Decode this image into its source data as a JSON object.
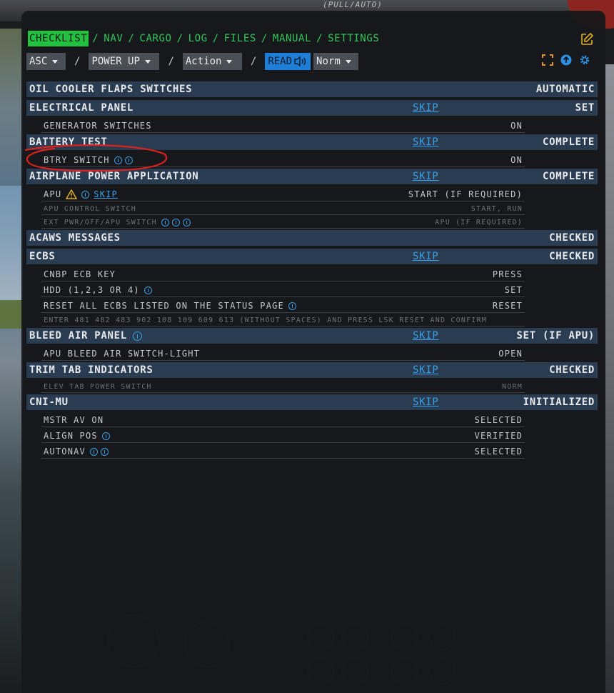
{
  "background": {
    "top_label": "(PULL/AUTO)"
  },
  "tabs": [
    {
      "label": "CHECKLIST",
      "active": true
    },
    {
      "label": "NAV"
    },
    {
      "label": "CARGO"
    },
    {
      "label": "LOG"
    },
    {
      "label": "FILES"
    },
    {
      "label": "MANUAL"
    },
    {
      "label": "SETTINGS"
    }
  ],
  "toolbar": {
    "dropdown_1": "ASC",
    "dropdown_2": "POWER UP",
    "dropdown_3": "Action",
    "separator": "/",
    "read_label": "READ",
    "mode": "Norm"
  },
  "colors": {
    "tab_green": "#32c75a",
    "section_bg": "#2a3c52",
    "link_blue": "#3aa0e6",
    "read_blue": "#1f7fd6",
    "icon_orange": "#e8912b",
    "warning_yellow": "#e0b020",
    "annotation_red": "#e0201a"
  },
  "icons": {
    "edit": "pencil-square-icon",
    "fullscreen": "expand-corners-icon",
    "upload": "arrow-up-circle-icon",
    "settings": "gear-icon",
    "speaker": "speaker-icon",
    "info": "info-circle-icon",
    "warning": "warning-triangle-icon"
  },
  "checklist": {
    "sections": {
      "oil_cooler": {
        "label": "OIL COOLER FLAPS SWITCHES",
        "value": "AUTOMATIC"
      },
      "electrical": {
        "label": "ELECTRICAL PANEL",
        "skip": "SKIP",
        "value": "SET"
      },
      "battery": {
        "label": "BATTERY TEST",
        "skip": "SKIP",
        "value": "COMPLETE"
      },
      "airplane_power": {
        "label": "AIRPLANE POWER APPLICATION",
        "skip": "SKIP",
        "value": "COMPLETE"
      },
      "acaws": {
        "label": "ACAWS MESSAGES",
        "value": "CHECKED"
      },
      "ecbs": {
        "label": "ECBS",
        "skip": "SKIP",
        "value": "CHECKED"
      },
      "bleed_air": {
        "label": "BLEED AIR PANEL",
        "skip": "SKIP",
        "value": "SET (IF APU)"
      },
      "trim_tab": {
        "label": "TRIM TAB INDICATORS",
        "skip": "SKIP",
        "value": "CHECKED"
      },
      "cni_mu": {
        "label": "CNI-MU",
        "skip": "SKIP",
        "value": "INITIALIZED"
      }
    },
    "items": {
      "generator_switches": {
        "label": "GENERATOR SWITCHES",
        "value": "ON"
      },
      "btry_switch": {
        "label": "BTRY SWITCH",
        "value": "ON"
      },
      "apu": {
        "label": "APU",
        "skip": "SKIP",
        "value": "START (IF REQUIRED)"
      },
      "apu_control_switch": {
        "label": "APU CONTROL SWITCH",
        "value": "START, RUN"
      },
      "ext_pwr_switch": {
        "label": "EXT PWR/OFF/APU SWITCH",
        "value": "APU (IF REQUIRED)"
      },
      "cnbp_ecb_key": {
        "label": "CNBP ECB KEY",
        "value": "PRESS"
      },
      "hdd": {
        "label": "HDD (1,2,3 OR 4)",
        "value": "SET"
      },
      "reset_ecbs": {
        "label": "RESET ALL ECBS LISTED ON THE STATUS PAGE",
        "value": "RESET"
      },
      "enter_codes": {
        "label": "ENTER 481 482 483 902 108 109 609 613 (WITHOUT SPACES) AND PRESS LSK RESET AND CONFIRM",
        "value": ""
      },
      "apu_bleed": {
        "label": "APU BLEED AIR SWITCH-LIGHT",
        "value": "OPEN"
      },
      "elev_tab": {
        "label": "ELEV TAB POWER SWITCH",
        "value": "NORM"
      },
      "mstr_av": {
        "label": "MSTR AV ON",
        "value": "SELECTED"
      },
      "align_pos": {
        "label": "ALIGN POS",
        "value": "VERIFIED"
      },
      "autonav": {
        "label": "AUTONAV",
        "value": "SELECTED"
      }
    }
  }
}
